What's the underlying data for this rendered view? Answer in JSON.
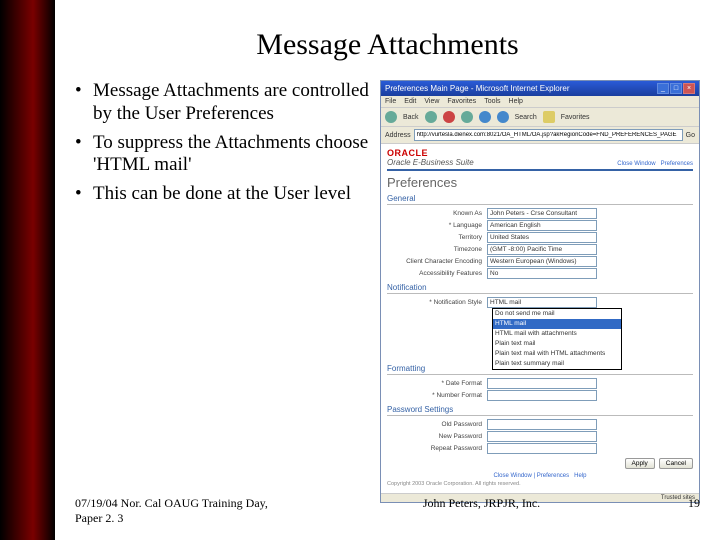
{
  "title": "Message Attachments",
  "bullets": [
    "Message Attachments are controlled by the User Preferences",
    "To suppress the Attachments choose 'HTML mail'",
    "This can be done at the User level"
  ],
  "browser": {
    "window_title": "Preferences Main Page - Microsoft Internet Explorer",
    "menu": [
      "File",
      "Edit",
      "View",
      "Favorites",
      "Tools",
      "Help"
    ],
    "toolbar": {
      "back": "Back",
      "search": "Search",
      "favorites": "Favorites"
    },
    "address_label": "Address",
    "address_value": "http://vurtesla.dienex.com:8021/OA_HTML/OA.jsp?akRegionCode=FND_PREFERENCES_PAGE",
    "go": "Go"
  },
  "oracle": {
    "brand": "ORACLE",
    "suite": "Oracle E-Business Suite",
    "links": {
      "close": "Close Window",
      "prefs": "Preferences"
    }
  },
  "page_title": "Preferences",
  "sections": {
    "general": {
      "title": "General",
      "known_as": {
        "label": "Known As",
        "value": "John Peters - Crse Consultant"
      },
      "language": {
        "label": "* Language",
        "value": "American English"
      },
      "territory": {
        "label": "Territory",
        "value": "United States"
      },
      "timezone": {
        "label": "Timezone",
        "value": "(GMT -8:00) Pacific Time"
      },
      "encoding": {
        "label": "Client Character Encoding",
        "value": "Western European (Windows)"
      },
      "accessibility": {
        "label": "Accessibility Features",
        "value": "No"
      }
    },
    "notification": {
      "title": "Notification",
      "style_label": "* Notification Style",
      "style_value": "HTML mail",
      "options": [
        "Do not send me mail",
        "HTML mail",
        "HTML mail with attachments",
        "Plain text mail",
        "Plain text mail with HTML attachments",
        "Plain text summary mail"
      ]
    },
    "formatting": {
      "title": "Formatting",
      "date": {
        "label": "* Date Format",
        "value": ""
      },
      "number": {
        "label": "* Number Format",
        "value": ""
      }
    },
    "password": {
      "title": "Password Settings",
      "old": "Old Password",
      "new": "New Password",
      "repeat": "Repeat Password"
    }
  },
  "buttons": {
    "apply": "Apply",
    "cancel": "Cancel"
  },
  "pagefoot": {
    "close": "Close Window",
    "prefs": "Preferences",
    "help": "Help"
  },
  "copyright": "Copyright 2003 Oracle Corporation. All rights reserved.",
  "status": {
    "left": "",
    "right": "Trusted sites"
  },
  "footer": {
    "left": "07/19/04 Nor. Cal OAUG Training Day, Paper 2. 3",
    "center": "John Peters, JRPJR, Inc.",
    "right": "19"
  }
}
